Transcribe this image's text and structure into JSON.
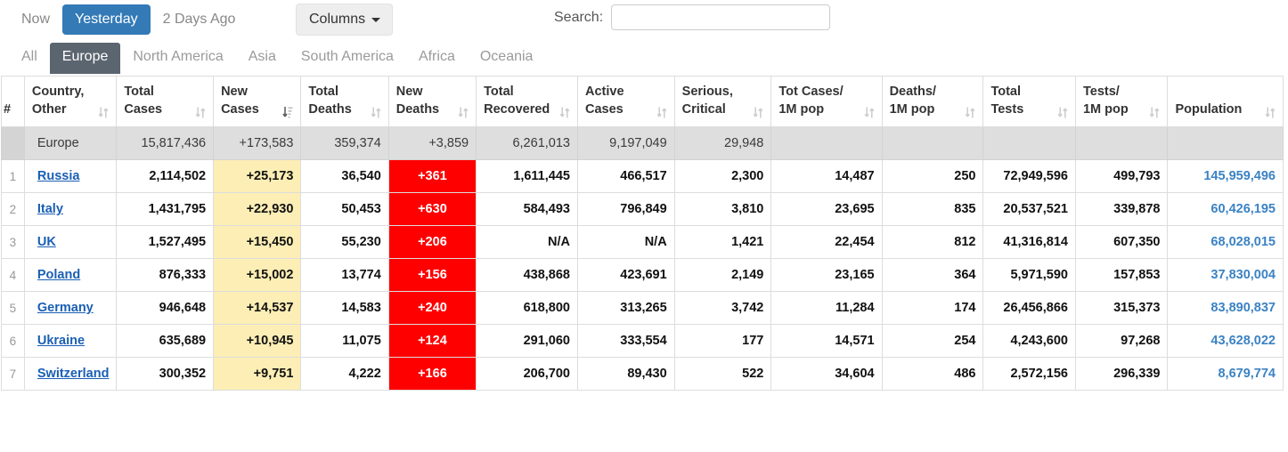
{
  "toolbar": {
    "day_buttons": [
      {
        "label": "Now",
        "active": false
      },
      {
        "label": "Yesterday",
        "active": true
      },
      {
        "label": "2 Days Ago",
        "active": false
      }
    ],
    "columns_label": "Columns",
    "search_label": "Search:",
    "search_value": "",
    "search_placeholder": "",
    "active_color": "#337ab7"
  },
  "tabs": [
    {
      "label": "All",
      "active": false
    },
    {
      "label": "Europe",
      "active": true
    },
    {
      "label": "North America",
      "active": false
    },
    {
      "label": "Asia",
      "active": false
    },
    {
      "label": "South America",
      "active": false
    },
    {
      "label": "Africa",
      "active": false
    },
    {
      "label": "Oceania",
      "active": false
    }
  ],
  "table": {
    "headers": [
      {
        "line1": "",
        "line2": "#",
        "sort": "none"
      },
      {
        "line1": "Country,",
        "line2": "Other",
        "sort": "both"
      },
      {
        "line1": "Total",
        "line2": "Cases",
        "sort": "both"
      },
      {
        "line1": "New",
        "line2": "Cases",
        "sort": "desc"
      },
      {
        "line1": "Total",
        "line2": "Deaths",
        "sort": "both"
      },
      {
        "line1": "New",
        "line2": "Deaths",
        "sort": "both"
      },
      {
        "line1": "Total",
        "line2": "Recovered",
        "sort": "both"
      },
      {
        "line1": "Active",
        "line2": "Cases",
        "sort": "both"
      },
      {
        "line1": "Serious,",
        "line2": "Critical",
        "sort": "both"
      },
      {
        "line1": "Tot Cases/",
        "line2": "1M pop",
        "sort": "both"
      },
      {
        "line1": "Deaths/",
        "line2": "1M pop",
        "sort": "both"
      },
      {
        "line1": "Total",
        "line2": "Tests",
        "sort": "both"
      },
      {
        "line1": "Tests/",
        "line2": "1M pop",
        "sort": "both"
      },
      {
        "line1": "",
        "line2": "Population",
        "sort": "both"
      }
    ],
    "total_row": {
      "index": "",
      "country": "Europe",
      "total_cases": "15,817,436",
      "new_cases": "+173,583",
      "total_deaths": "359,374",
      "new_deaths": "+3,859",
      "total_recovered": "6,261,013",
      "active_cases": "9,197,049",
      "serious_critical": "29,948",
      "tot_cases_1m": "",
      "deaths_1m": "",
      "total_tests": "",
      "tests_1m": "",
      "population": ""
    },
    "rows": [
      {
        "index": "1",
        "country": "Russia",
        "total_cases": "2,114,502",
        "new_cases": "+25,173",
        "total_deaths": "36,540",
        "new_deaths": "+361",
        "total_recovered": "1,611,445",
        "active_cases": "466,517",
        "serious_critical": "2,300",
        "tot_cases_1m": "14,487",
        "deaths_1m": "250",
        "total_tests": "72,949,596",
        "tests_1m": "499,793",
        "population": "145,959,496"
      },
      {
        "index": "2",
        "country": "Italy",
        "total_cases": "1,431,795",
        "new_cases": "+22,930",
        "total_deaths": "50,453",
        "new_deaths": "+630",
        "total_recovered": "584,493",
        "active_cases": "796,849",
        "serious_critical": "3,810",
        "tot_cases_1m": "23,695",
        "deaths_1m": "835",
        "total_tests": "20,537,521",
        "tests_1m": "339,878",
        "population": "60,426,195"
      },
      {
        "index": "3",
        "country": "UK",
        "total_cases": "1,527,495",
        "new_cases": "+15,450",
        "total_deaths": "55,230",
        "new_deaths": "+206",
        "total_recovered": "N/A",
        "active_cases": "N/A",
        "serious_critical": "1,421",
        "tot_cases_1m": "22,454",
        "deaths_1m": "812",
        "total_tests": "41,316,814",
        "tests_1m": "607,350",
        "population": "68,028,015"
      },
      {
        "index": "4",
        "country": "Poland",
        "total_cases": "876,333",
        "new_cases": "+15,002",
        "total_deaths": "13,774",
        "new_deaths": "+156",
        "total_recovered": "438,868",
        "active_cases": "423,691",
        "serious_critical": "2,149",
        "tot_cases_1m": "23,165",
        "deaths_1m": "364",
        "total_tests": "5,971,590",
        "tests_1m": "157,853",
        "population": "37,830,004"
      },
      {
        "index": "5",
        "country": "Germany",
        "total_cases": "946,648",
        "new_cases": "+14,537",
        "total_deaths": "14,583",
        "new_deaths": "+240",
        "total_recovered": "618,800",
        "active_cases": "313,265",
        "serious_critical": "3,742",
        "tot_cases_1m": "11,284",
        "deaths_1m": "174",
        "total_tests": "26,456,866",
        "tests_1m": "315,373",
        "population": "83,890,837"
      },
      {
        "index": "6",
        "country": "Ukraine",
        "total_cases": "635,689",
        "new_cases": "+10,945",
        "total_deaths": "11,075",
        "new_deaths": "+124",
        "total_recovered": "291,060",
        "active_cases": "333,554",
        "serious_critical": "177",
        "tot_cases_1m": "14,571",
        "deaths_1m": "254",
        "total_tests": "4,243,600",
        "tests_1m": "97,268",
        "population": "43,628,022"
      },
      {
        "index": "7",
        "country": "Switzerland",
        "total_cases": "300,352",
        "new_cases": "+9,751",
        "total_deaths": "4,222",
        "new_deaths": "+166",
        "total_recovered": "206,700",
        "active_cases": "89,430",
        "serious_critical": "522",
        "tot_cases_1m": "34,604",
        "deaths_1m": "486",
        "total_tests": "2,572,156",
        "tests_1m": "296,339",
        "population": "8,679,774"
      }
    ]
  },
  "colors": {
    "new_cases_bg": "#fceeb5",
    "new_deaths_bg": "#ff0000",
    "total_row_bg": "#dedede",
    "link": "#1a5fb4",
    "population": "#3b82c4",
    "tab_active_bg": "#5b6570"
  }
}
